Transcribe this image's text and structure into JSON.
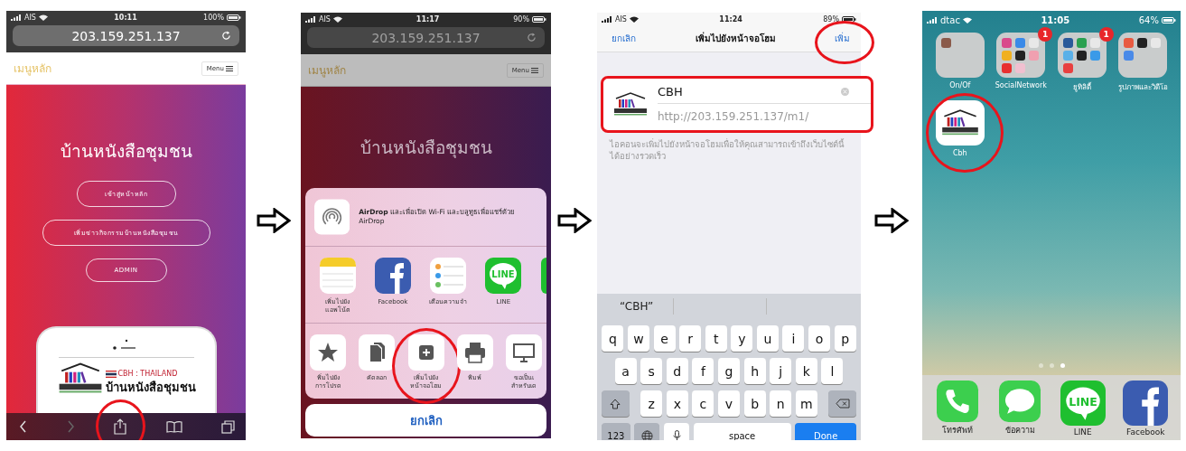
{
  "browser_screen": {
    "status": {
      "carrier": "AIS",
      "time": "10:11",
      "battery": "100%"
    },
    "url": "203.159.251.137",
    "site_title": "เมนูหลัก",
    "menu_button": "Menu",
    "hero_title": "บ้านหนังสือชุมชน",
    "hero_buttons": [
      "เข้าสู่หน้าหลัก",
      "เพิ่มข่าวกิจกรรมบ้านหนังสือชุมชน",
      "ADMIN"
    ],
    "preview": {
      "flag_label": "CBH : THAILAND",
      "logo_text": "บ้านหนังสือชุมชน"
    },
    "toolbar": [
      {
        "kind": "back",
        "highlighted": false
      },
      {
        "kind": "forward",
        "highlighted": false
      },
      {
        "kind": "share",
        "highlighted": true
      },
      {
        "kind": "bookmarks",
        "highlighted": false
      },
      {
        "kind": "tabs",
        "highlighted": false
      }
    ]
  },
  "share_sheet_screen": {
    "status": {
      "carrier": "AIS",
      "time": "11:17",
      "battery": "90%"
    },
    "url": "203.159.251.137",
    "site_title": "เมนูหลัก",
    "menu_button": "Menu",
    "hero_title": "บ้านหนังสือชุมชน",
    "airdrop_text": "**AirDrop** และเพื่อเปิด Wi-Fi และบลูทูธเพื่อแชร์ด้วย AirDrop",
    "apps": [
      {
        "kind": "notes",
        "label": "เพิ่มไปยัง\nแอพโน้ต"
      },
      {
        "kind": "facebook",
        "label": "Facebook"
      },
      {
        "kind": "reminders",
        "label": "เตือนความจำ"
      },
      {
        "kind": "line",
        "label": "LINE",
        "icon_text": "LINE"
      },
      {
        "kind": "partial"
      }
    ],
    "actions": [
      {
        "kind": "star",
        "label": "พิ่มไปยัง\nการโปรด",
        "highlighted": false
      },
      {
        "kind": "copy",
        "label": "คัดลอก",
        "highlighted": false
      },
      {
        "kind": "add",
        "label": "เพิ่มไปยัง\nหน้าจอโฮม",
        "highlighted": true
      },
      {
        "kind": "print",
        "label": "พิมพ์",
        "highlighted": false
      },
      {
        "kind": "desktop",
        "label": "ขอเป็นเ\nสำหรับเด",
        "highlighted": false
      }
    ],
    "cancel_button": "ยกเลิก"
  },
  "add_to_home_screen": {
    "status": {
      "carrier": "AIS",
      "time": "11:24",
      "battery": "89%"
    },
    "cancel_button": "ยกเลิก",
    "title": "เพิ่มไปยังหน้าจอโฮม",
    "add_button": {
      "label": "เพิ่ม",
      "highlighted": true
    },
    "fields": {
      "name": "CBH",
      "url": "http://203.159.251.137/m1/",
      "highlighted": true
    },
    "description": "ไอคอนจะเพิ่มไปยังหน้าจอโฮมเพื่อให้คุณสามารถเข้าถึงเว็บไซต์นี้ได้อย่างรวดเร็ว",
    "suggestion": "“CBH”",
    "key_rows": [
      [
        "q",
        "w",
        "e",
        "r",
        "t",
        "y",
        "u",
        "i",
        "o",
        "p"
      ],
      [
        "a",
        "s",
        "d",
        "f",
        "g",
        "h",
        "j",
        "k",
        "l"
      ],
      [
        "z",
        "x",
        "c",
        "v",
        "b",
        "n",
        "m"
      ]
    ],
    "numbers_key": "123",
    "space_key": "space",
    "done_key": "Done"
  },
  "home_screen": {
    "status": {
      "carrier": "dtac",
      "time": "11:05",
      "battery": "64%"
    },
    "folders": [
      {
        "label": "On/Of"
      },
      {
        "label": "SocialNetwork",
        "badge": "1"
      },
      {
        "label": "ยูทิลิตี้",
        "badge": "1"
      },
      {
        "label": "รูปภาพและวิดีโอ"
      }
    ],
    "web_app": {
      "label": "Cbh",
      "highlighted": true
    },
    "page_dots": [
      {
        "selected": false
      },
      {
        "selected": false
      },
      {
        "selected": true
      }
    ],
    "dock": [
      {
        "kind": "phone",
        "label": "โทรศัพท์"
      },
      {
        "kind": "messages",
        "label": "ข้อความ"
      },
      {
        "kind": "line",
        "label": "LINE",
        "icon_text": "LINE"
      },
      {
        "kind": "facebook",
        "label": "Facebook"
      }
    ]
  }
}
